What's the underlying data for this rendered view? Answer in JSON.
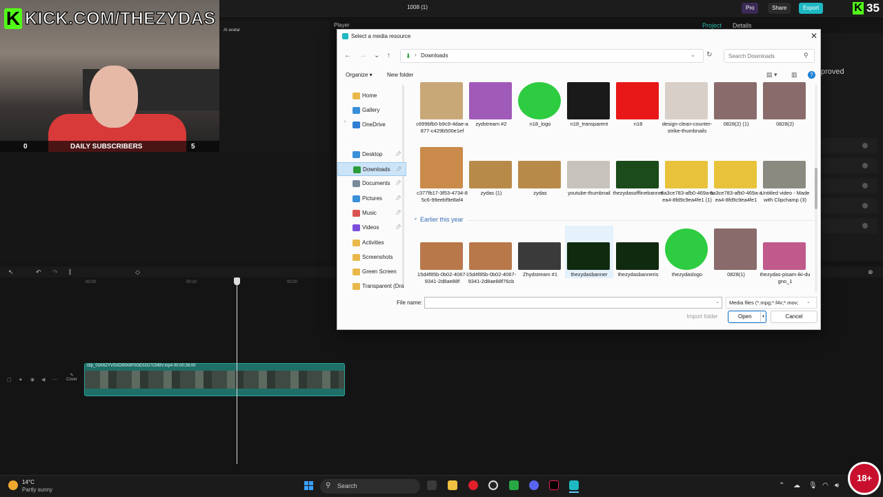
{
  "editor": {
    "project_title": "1008 (1)",
    "pro_label": "Pro",
    "share_label": "Share",
    "export_label": "Export",
    "player_label": "Player",
    "tab_project": "Project",
    "tab_details": "Details",
    "approved_text": "proved",
    "ai_avatar_label": "AI avatar",
    "ruler_ticks": [
      "00:00",
      "00:10",
      "00:20"
    ],
    "clip_label": "clip_01K6ZYVSXD90X6F0GE02G7CM9V.mp4   00:00:26:00",
    "cover_label": "Cover",
    "accent_color": "#2aa398"
  },
  "stream_overlay": {
    "kick_url": "KICK.COM/THEZYDAS",
    "subs_left": "0",
    "subs_label": "DAILY SUBSCRIBERS",
    "subs_right": "5",
    "kick_count": "35",
    "age_badge": "18+",
    "brand_color": "#53fc18"
  },
  "dialog": {
    "title": "Select a media resource",
    "address": "Downloads",
    "search_placeholder": "Search Downloads",
    "organize_label": "Organize ▾",
    "new_folder_label": "New folder",
    "sidebar": [
      {
        "label": "Home",
        "icon": "home-icon",
        "color": "#e8b84a"
      },
      {
        "label": "Gallery",
        "icon": "gallery-icon",
        "color": "#3a8fd9"
      },
      {
        "label": "OneDrive",
        "icon": "cloud-icon",
        "color": "#2f7fd4"
      },
      {
        "label": "Desktop",
        "icon": "desktop-icon",
        "color": "#3a8fd9"
      },
      {
        "label": "Downloads",
        "icon": "download-icon",
        "color": "#2a9d3a"
      },
      {
        "label": "Documents",
        "icon": "document-icon",
        "color": "#7a8a99"
      },
      {
        "label": "Pictures",
        "icon": "pictures-icon",
        "color": "#3a8fd9"
      },
      {
        "label": "Music",
        "icon": "music-icon",
        "color": "#d9534f"
      },
      {
        "label": "Videos",
        "icon": "videos-icon",
        "color": "#7b4fd9"
      },
      {
        "label": "Activities",
        "icon": "folder-icon",
        "color": "#e8b84a"
      },
      {
        "label": "Screenshots",
        "icon": "folder-icon",
        "color": "#e8b84a"
      },
      {
        "label": "Green Screen",
        "icon": "folder-icon",
        "color": "#e8b84a"
      },
      {
        "label": "Transparent (Dra",
        "icon": "folder-icon",
        "color": "#e8b84a"
      }
    ],
    "files_row1": [
      {
        "name": "c699bfb0-b9c9-4dae-a877-c429b500e1ef",
        "color": "#c9a878"
      },
      {
        "name": "zydstream #2",
        "color": "#a05ab8"
      },
      {
        "name": "n18_logo",
        "color": "#2ecc40"
      },
      {
        "name": "n18_transparent",
        "color": "#1a1a1a"
      },
      {
        "name": "n18",
        "color": "#e81818"
      },
      {
        "name": "design-clean-counter-strike-thumbnails",
        "color": "#d8d0c8"
      },
      {
        "name": "0828(2) (1)",
        "color": "#8a6b6b"
      },
      {
        "name": "0828(2)",
        "color": "#8a6b6b"
      }
    ],
    "files_row2": [
      {
        "name": "c377fb17-3f53-4734-85c6-99eebf9e8af4",
        "color": "#c98a4a"
      },
      {
        "name": "zydas (1)",
        "color": "#b88a4a"
      },
      {
        "name": "zydas",
        "color": "#b88a4a"
      },
      {
        "name": "youtube-thumbnail",
        "color": "#c8c2bc"
      },
      {
        "name": "thezydasofflinebanner",
        "color": "#1b4a1b"
      },
      {
        "name": "6a3ce783-afb0-469a-aea4-8fd9c9ea4fe1 (1)",
        "color": "#e8c23a"
      },
      {
        "name": "6a3ce783-afb0-469a-aea4-8fd9c9ea4fe1",
        "color": "#e8c23a"
      },
      {
        "name": "Untitled video - Made with Clipchamp (3)",
        "color": "#8a8a80"
      }
    ],
    "group_header": "Earlier this year",
    "files_row3": [
      {
        "name": "15d4f85b-0b02-4067-9341-2d8ae88f",
        "color": "#b8784a"
      },
      {
        "name": "15d4f85b-0b02-4067-9341-2d8ae88f76cb",
        "color": "#b8784a"
      },
      {
        "name": "Zhydstream #1",
        "color": "#3a3a3a"
      },
      {
        "name": "thezydasbanner",
        "color": "#0f2a0f"
      },
      {
        "name": "thezydasbanneris",
        "color": "#0f2a0f"
      },
      {
        "name": "thezydaslogo",
        "color": "#2ecc40"
      },
      {
        "name": "0828(1)",
        "color": "#8a6b6b"
      },
      {
        "name": "thezydas-pisam-iki-dugno_1",
        "color": "#c05a8a"
      }
    ],
    "filename_label": "File name:",
    "filename_value": "",
    "filetype": "Media files (*.mpg;*.f4v;*.mov;",
    "import_folder_label": "Import folder",
    "open_label": "Open",
    "cancel_label": "Cancel"
  },
  "taskbar": {
    "temperature": "14°C",
    "weather": "Partly sunny",
    "search_label": "Search"
  }
}
